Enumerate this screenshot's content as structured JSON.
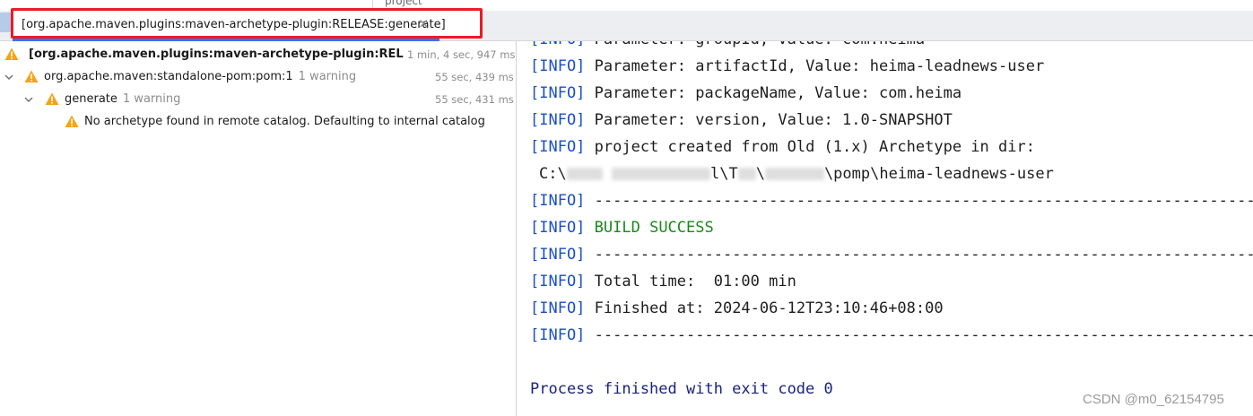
{
  "top": {
    "project_label": "project"
  },
  "tab": {
    "title": "[org.apache.maven.plugins:maven-archetype-plugin:RELEASE:generate]",
    "close_glyph": "×"
  },
  "tree": {
    "root": {
      "label": "[org.apache.maven.plugins:maven-archetype-plugin:RELEASE:g",
      "time": "1 min, 4 sec, 947 ms",
      "icon": "warning-icon"
    },
    "child": {
      "label": "org.apache.maven:standalone-pom:pom:1",
      "count": "1 warning",
      "time": "55 sec, 439 ms",
      "icon": "warning-icon"
    },
    "grandchild": {
      "label": "generate",
      "count": "1 warning",
      "time": "55 sec, 431 ms",
      "icon": "warning-icon"
    },
    "message": {
      "label": "No archetype found in remote catalog. Defaulting to internal catalog",
      "icon": "warning-icon"
    }
  },
  "console": {
    "info_tag": "[INFO]",
    "line0": "Parameter: groupId, Value: com.heima",
    "line1": "Parameter: artifactId, Value: heima-leadnews-user",
    "line2": "Parameter: packageName, Value: com.heima",
    "line3": "Parameter: version, Value: 1.0-SNAPSHOT",
    "line4": "project created from Old (1.x) Archetype in dir:",
    "path_prefix": "C:\\",
    "path_mid1": "l\\T",
    "path_mid2": "\\",
    "path_mid3": "\\pomp",
    "path_suffix": "\\heima-leadnews-user",
    "dashes": "------------------------------------------------------------------------",
    "build_success": "BUILD SUCCESS",
    "total_time": "Total time:  01:00 min",
    "finished_at": "Finished at: 2024-06-12T23:10:46+08:00",
    "exit": "Process finished with exit code 0"
  },
  "watermark": "CSDN @m0_62154795",
  "colors": {
    "info": "#1b4fc6",
    "success": "#1a8a1a",
    "warning": "#f2a515",
    "highlight": "#ec1c24",
    "accent": "#3574f0"
  }
}
